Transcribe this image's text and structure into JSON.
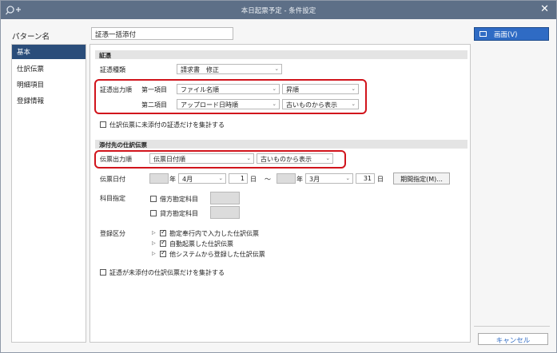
{
  "window": {
    "title": "本日起票予定 - 条件設定",
    "close": "✕"
  },
  "pattern": {
    "label": "パターン名",
    "value": "証憑一括添付"
  },
  "sidebar": {
    "items": [
      {
        "label": "基本"
      },
      {
        "label": "仕訳伝票"
      },
      {
        "label": "明細項目"
      },
      {
        "label": "登録情報"
      }
    ]
  },
  "evidence": {
    "section": "証憑",
    "type_label": "証憑種類",
    "type_value": "請求書　修正",
    "order_label": "証憑出力順",
    "first_label": "第一項目",
    "first_value": "ファイル名順",
    "first_dir": "昇順",
    "second_label": "第二項目",
    "second_value": "アップロード日時順",
    "second_dir": "古いものから表示",
    "check_label": "仕訳伝票に未添付の証憑だけを集計する"
  },
  "voucher": {
    "section": "添付先の仕訳伝票",
    "order_label": "伝票出力順",
    "order_value": "伝票日付順",
    "order_dir": "古いものから表示",
    "date_label": "伝票日付",
    "from_year_unit": "年",
    "from_month": "4月",
    "from_day": "1",
    "day_unit": "日",
    "tilde": "～",
    "to_year_unit": "年",
    "to_month": "3月",
    "to_day": "31",
    "period_button": "期間指定(M)...",
    "account_label": "科目指定",
    "debit_label": "借方勘定科目",
    "credit_label": "貸方勘定科目",
    "reg_label": "登録区分",
    "reg_items": [
      {
        "label": "勘定奉行内で入力した仕訳伝票",
        "checked": true
      },
      {
        "label": "自動起票した仕訳伝票",
        "checked": true
      },
      {
        "label": "他システムから登録した仕訳伝票",
        "checked": true
      }
    ],
    "bottom_check": "証憑が未添付の仕訳伝票だけを集計する"
  },
  "right": {
    "screen_button": "画面(V)",
    "cancel_button": "キャンセル"
  },
  "colors": {
    "titlebar": "#5d6f87",
    "accent": "#2a4d7a",
    "highlight": "#d1141c",
    "primary_button": "#2f6bc4"
  }
}
